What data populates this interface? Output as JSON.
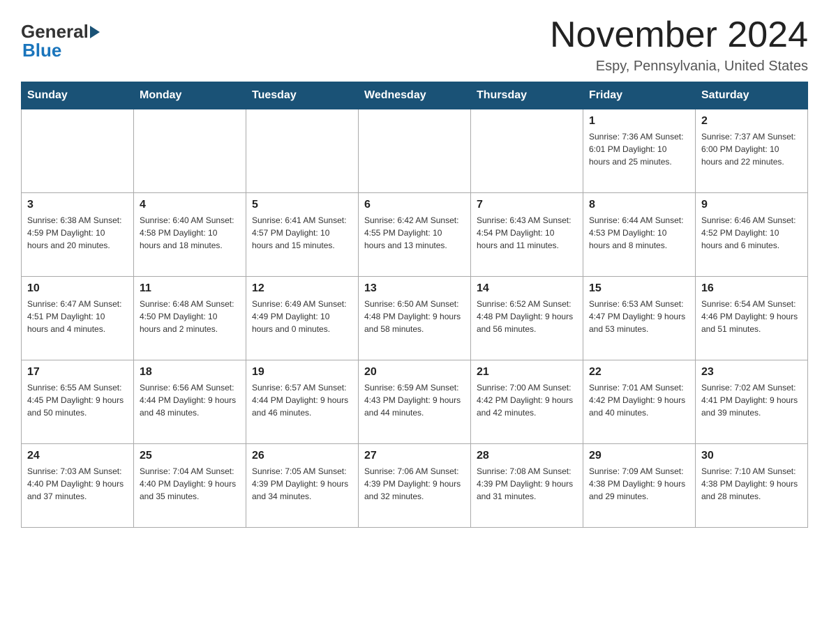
{
  "header": {
    "logo_general": "General",
    "logo_blue": "Blue",
    "title": "November 2024",
    "subtitle": "Espy, Pennsylvania, United States"
  },
  "weekdays": [
    "Sunday",
    "Monday",
    "Tuesday",
    "Wednesday",
    "Thursday",
    "Friday",
    "Saturday"
  ],
  "weeks": [
    [
      {
        "day": "",
        "info": ""
      },
      {
        "day": "",
        "info": ""
      },
      {
        "day": "",
        "info": ""
      },
      {
        "day": "",
        "info": ""
      },
      {
        "day": "",
        "info": ""
      },
      {
        "day": "1",
        "info": "Sunrise: 7:36 AM\nSunset: 6:01 PM\nDaylight: 10 hours and 25 minutes."
      },
      {
        "day": "2",
        "info": "Sunrise: 7:37 AM\nSunset: 6:00 PM\nDaylight: 10 hours and 22 minutes."
      }
    ],
    [
      {
        "day": "3",
        "info": "Sunrise: 6:38 AM\nSunset: 4:59 PM\nDaylight: 10 hours and 20 minutes."
      },
      {
        "day": "4",
        "info": "Sunrise: 6:40 AM\nSunset: 4:58 PM\nDaylight: 10 hours and 18 minutes."
      },
      {
        "day": "5",
        "info": "Sunrise: 6:41 AM\nSunset: 4:57 PM\nDaylight: 10 hours and 15 minutes."
      },
      {
        "day": "6",
        "info": "Sunrise: 6:42 AM\nSunset: 4:55 PM\nDaylight: 10 hours and 13 minutes."
      },
      {
        "day": "7",
        "info": "Sunrise: 6:43 AM\nSunset: 4:54 PM\nDaylight: 10 hours and 11 minutes."
      },
      {
        "day": "8",
        "info": "Sunrise: 6:44 AM\nSunset: 4:53 PM\nDaylight: 10 hours and 8 minutes."
      },
      {
        "day": "9",
        "info": "Sunrise: 6:46 AM\nSunset: 4:52 PM\nDaylight: 10 hours and 6 minutes."
      }
    ],
    [
      {
        "day": "10",
        "info": "Sunrise: 6:47 AM\nSunset: 4:51 PM\nDaylight: 10 hours and 4 minutes."
      },
      {
        "day": "11",
        "info": "Sunrise: 6:48 AM\nSunset: 4:50 PM\nDaylight: 10 hours and 2 minutes."
      },
      {
        "day": "12",
        "info": "Sunrise: 6:49 AM\nSunset: 4:49 PM\nDaylight: 10 hours and 0 minutes."
      },
      {
        "day": "13",
        "info": "Sunrise: 6:50 AM\nSunset: 4:48 PM\nDaylight: 9 hours and 58 minutes."
      },
      {
        "day": "14",
        "info": "Sunrise: 6:52 AM\nSunset: 4:48 PM\nDaylight: 9 hours and 56 minutes."
      },
      {
        "day": "15",
        "info": "Sunrise: 6:53 AM\nSunset: 4:47 PM\nDaylight: 9 hours and 53 minutes."
      },
      {
        "day": "16",
        "info": "Sunrise: 6:54 AM\nSunset: 4:46 PM\nDaylight: 9 hours and 51 minutes."
      }
    ],
    [
      {
        "day": "17",
        "info": "Sunrise: 6:55 AM\nSunset: 4:45 PM\nDaylight: 9 hours and 50 minutes."
      },
      {
        "day": "18",
        "info": "Sunrise: 6:56 AM\nSunset: 4:44 PM\nDaylight: 9 hours and 48 minutes."
      },
      {
        "day": "19",
        "info": "Sunrise: 6:57 AM\nSunset: 4:44 PM\nDaylight: 9 hours and 46 minutes."
      },
      {
        "day": "20",
        "info": "Sunrise: 6:59 AM\nSunset: 4:43 PM\nDaylight: 9 hours and 44 minutes."
      },
      {
        "day": "21",
        "info": "Sunrise: 7:00 AM\nSunset: 4:42 PM\nDaylight: 9 hours and 42 minutes."
      },
      {
        "day": "22",
        "info": "Sunrise: 7:01 AM\nSunset: 4:42 PM\nDaylight: 9 hours and 40 minutes."
      },
      {
        "day": "23",
        "info": "Sunrise: 7:02 AM\nSunset: 4:41 PM\nDaylight: 9 hours and 39 minutes."
      }
    ],
    [
      {
        "day": "24",
        "info": "Sunrise: 7:03 AM\nSunset: 4:40 PM\nDaylight: 9 hours and 37 minutes."
      },
      {
        "day": "25",
        "info": "Sunrise: 7:04 AM\nSunset: 4:40 PM\nDaylight: 9 hours and 35 minutes."
      },
      {
        "day": "26",
        "info": "Sunrise: 7:05 AM\nSunset: 4:39 PM\nDaylight: 9 hours and 34 minutes."
      },
      {
        "day": "27",
        "info": "Sunrise: 7:06 AM\nSunset: 4:39 PM\nDaylight: 9 hours and 32 minutes."
      },
      {
        "day": "28",
        "info": "Sunrise: 7:08 AM\nSunset: 4:39 PM\nDaylight: 9 hours and 31 minutes."
      },
      {
        "day": "29",
        "info": "Sunrise: 7:09 AM\nSunset: 4:38 PM\nDaylight: 9 hours and 29 minutes."
      },
      {
        "day": "30",
        "info": "Sunrise: 7:10 AM\nSunset: 4:38 PM\nDaylight: 9 hours and 28 minutes."
      }
    ]
  ]
}
